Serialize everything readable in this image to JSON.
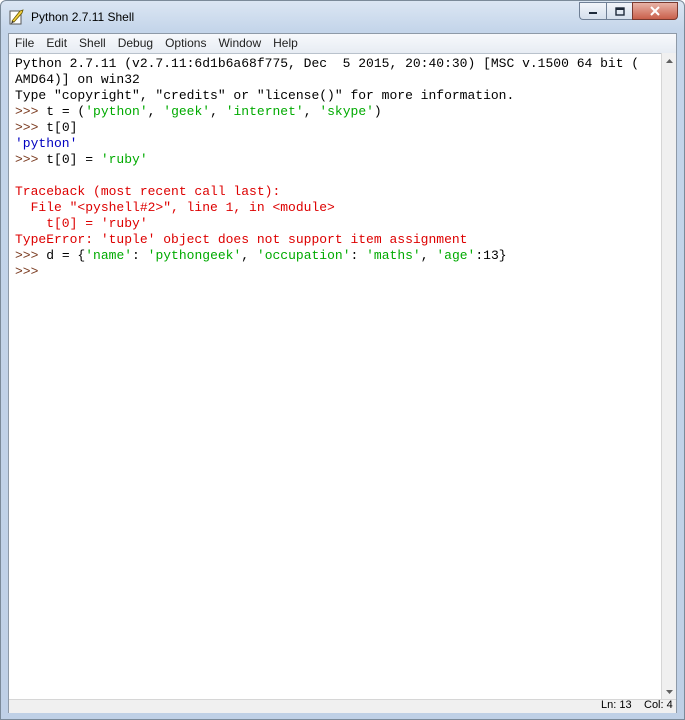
{
  "window": {
    "title": "Python 2.7.11 Shell",
    "icons": [
      "python-feather-icon",
      "minimize-icon",
      "maximize-icon",
      "close-icon"
    ]
  },
  "menu": [
    "File",
    "Edit",
    "Shell",
    "Debug",
    "Options",
    "Window",
    "Help"
  ],
  "shell_lines": [
    [
      {
        "t": "Python 2.7.11 (v2.7.11:6d1b6a68f775, Dec  5 2015, 20:40:30) [MSC v.1500 64 bit (",
        "c": "out"
      }
    ],
    [
      {
        "t": "AMD64)] on win32",
        "c": "out"
      }
    ],
    [
      {
        "t": "Type \"copyright\", \"credits\" or \"license()\" for more information.",
        "c": "out"
      }
    ],
    [
      {
        "t": ">>> ",
        "c": "prompt"
      },
      {
        "t": "t = (",
        "c": "code"
      },
      {
        "t": "'python'",
        "c": "str"
      },
      {
        "t": ", ",
        "c": "code"
      },
      {
        "t": "'geek'",
        "c": "str"
      },
      {
        "t": ", ",
        "c": "code"
      },
      {
        "t": "'internet'",
        "c": "str"
      },
      {
        "t": ", ",
        "c": "code"
      },
      {
        "t": "'skype'",
        "c": "str"
      },
      {
        "t": ")",
        "c": "code"
      }
    ],
    [
      {
        "t": ">>> ",
        "c": "prompt"
      },
      {
        "t": "t[0]",
        "c": "code"
      }
    ],
    [
      {
        "t": "'python'",
        "c": "result"
      }
    ],
    [
      {
        "t": ">>> ",
        "c": "prompt"
      },
      {
        "t": "t[0] = ",
        "c": "code"
      },
      {
        "t": "'ruby'",
        "c": "str"
      }
    ],
    [
      {
        "t": "",
        "c": "out"
      }
    ],
    [
      {
        "t": "Traceback (most recent call last):",
        "c": "err"
      }
    ],
    [
      {
        "t": "  File \"<pyshell#2>\", line 1, in <module>",
        "c": "err"
      }
    ],
    [
      {
        "t": "    t[0] = 'ruby'",
        "c": "err"
      }
    ],
    [
      {
        "t": "TypeError: 'tuple' object does not support item assignment",
        "c": "err"
      }
    ],
    [
      {
        "t": ">>> ",
        "c": "prompt"
      },
      {
        "t": "d = {",
        "c": "code"
      },
      {
        "t": "'name'",
        "c": "str"
      },
      {
        "t": ": ",
        "c": "code"
      },
      {
        "t": "'pythongeek'",
        "c": "str"
      },
      {
        "t": ", ",
        "c": "code"
      },
      {
        "t": "'occupation'",
        "c": "str"
      },
      {
        "t": ": ",
        "c": "code"
      },
      {
        "t": "'maths'",
        "c": "str"
      },
      {
        "t": ", ",
        "c": "code"
      },
      {
        "t": "'age'",
        "c": "str"
      },
      {
        "t": ":13}",
        "c": "code"
      }
    ],
    [
      {
        "t": ">>> ",
        "c": "prompt"
      }
    ]
  ],
  "status": {
    "ln": "Ln: 13",
    "col": "Col: 4"
  },
  "colors": {
    "prompt": "#7a3a1f",
    "string": "#00aa00",
    "result": "#0000c0",
    "error": "#dd0000"
  }
}
